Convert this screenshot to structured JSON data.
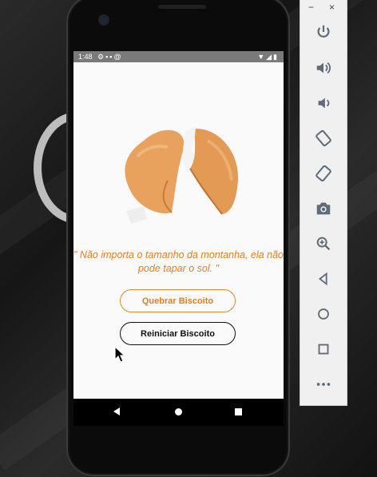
{
  "status_bar": {
    "time": "1:48",
    "left_icons": [
      "settings-icon",
      "sd-card-icon",
      "clipboard-icon",
      "at-icon"
    ],
    "right_icons": [
      "wifi-icon",
      "signal-icon",
      "battery-icon"
    ]
  },
  "app": {
    "quote": "\" Não importa o tamanho da montanha, ela não pode tapar o sol. \"",
    "break_button_label": "Quebrar Biscoito",
    "reset_button_label": "Reiniciar Biscoito",
    "colors": {
      "accent": "#e07f20",
      "background": "#fafafa",
      "dark": "#111111"
    }
  },
  "nav_bar": {
    "buttons": [
      "back-icon",
      "home-icon",
      "recents-icon"
    ]
  },
  "emulator_panel": {
    "window_controls": [
      "−",
      "×"
    ],
    "tools": [
      "power-icon",
      "volume-up-icon",
      "volume-down-icon",
      "rotate-left-icon",
      "rotate-right-icon",
      "camera-icon",
      "zoom-icon",
      "back-icon",
      "home-icon",
      "overview-icon",
      "more-icon"
    ]
  }
}
